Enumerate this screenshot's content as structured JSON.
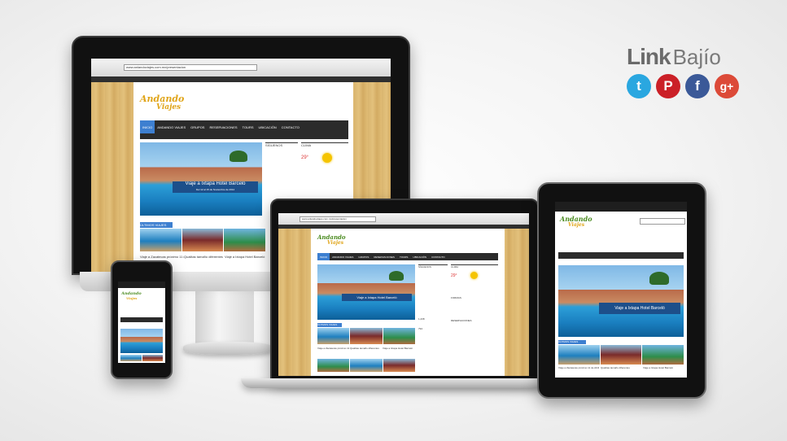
{
  "brand": {
    "link": "Link",
    "bajio": "Bajío"
  },
  "social": [
    {
      "icon": "twitter-icon",
      "glyph": "t"
    },
    {
      "icon": "pinterest-icon",
      "glyph": "P"
    },
    {
      "icon": "facebook-icon",
      "glyph": "f"
    },
    {
      "icon": "google-plus-icon",
      "glyph": "g+"
    }
  ],
  "site": {
    "url": "www.anlandoviajes.com.mx/presentacion",
    "logo_main": "Andando",
    "logo_sub": "Viajes",
    "nav": [
      "INICIO",
      "ANDANDO VIAJES",
      "GRUPOS",
      "RESERVACIONES",
      "TOURS",
      "UBICACIÓN",
      "CONTACTO"
    ],
    "banner_title": "Viaje a Ixtapa Hotel Barceló",
    "banner_subtitle": "Del 12 al 15 de Noviembre de 2014",
    "sidebar_titles": [
      "SÍGUENOS",
      "RESERVACIÓN",
      "CLIMA",
      "FORMAS",
      "RESERVACIONES"
    ],
    "weather_temp": "29°",
    "section_tag": "ÚLTIMOS VIAJES",
    "captions": [
      "Viaje a Zacatecas próximo 11 de Abril 2014",
      "Qualitas tamaño diferentes",
      "Viaje a Ixtapa Hotel Barceló"
    ],
    "stats": [
      "1,238",
      "794"
    ],
    "search_placeholder": "Buscar"
  },
  "colors": {
    "accent": "#3d7fd0",
    "dark_nav": "#2b2b2b",
    "brand_gray": "#6b6b6b"
  }
}
